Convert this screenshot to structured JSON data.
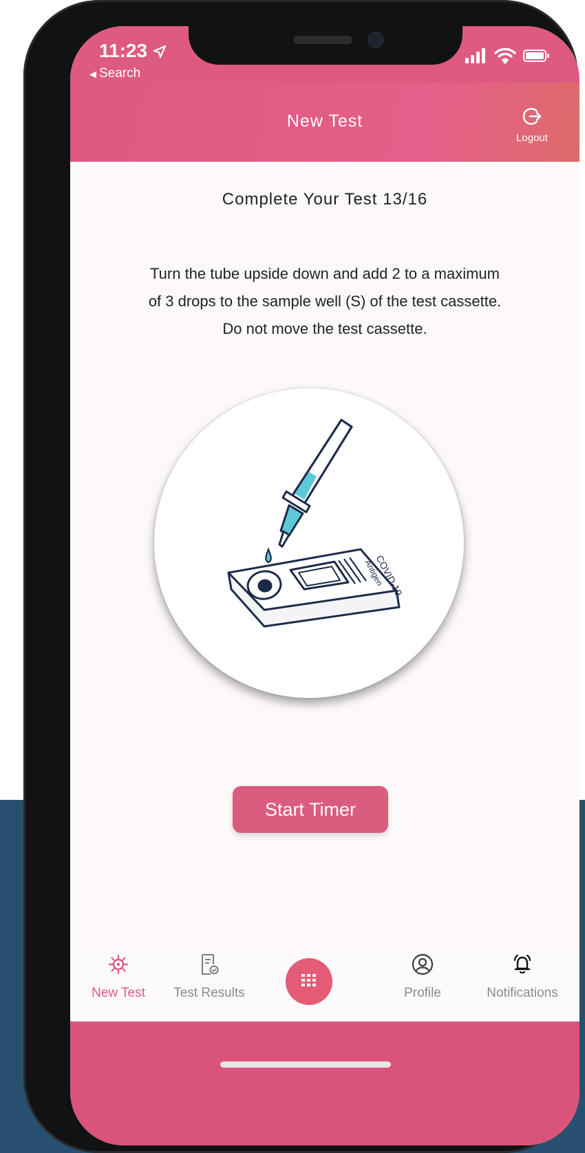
{
  "status_bar": {
    "time": "11:23",
    "location_arrow": "➤",
    "back_label": "Search",
    "back_arrow": "◀"
  },
  "header": {
    "title": "New Test",
    "logout_label": "Logout"
  },
  "content": {
    "title": "Complete Your Test 13/16",
    "instructions": [
      "Turn the tube upside down and add 2 to a maximum",
      "of 3 drops to the sample well (S) of the test cassette.",
      "Do not move the test cassette."
    ],
    "cassette_text_1": "COVID-19",
    "cassette_text_2": "Antigen",
    "button_label": "Start Timer"
  },
  "tabbar": {
    "items": [
      {
        "label": "New Test",
        "icon": "virus-icon",
        "active": true
      },
      {
        "label": "Test Results",
        "icon": "document-check-icon",
        "active": false
      },
      {
        "label": "",
        "icon": "grid-menu-icon",
        "active": false
      },
      {
        "label": "Profile",
        "icon": "user-circle-icon",
        "active": false
      },
      {
        "label": "Notifications",
        "icon": "bell-icon",
        "active": false
      }
    ]
  },
  "colors": {
    "brand_pink": "#da5c7e",
    "background_navy": "#27506f",
    "drop_teal": "#5ec9d6",
    "line_navy": "#1d2b4a"
  }
}
